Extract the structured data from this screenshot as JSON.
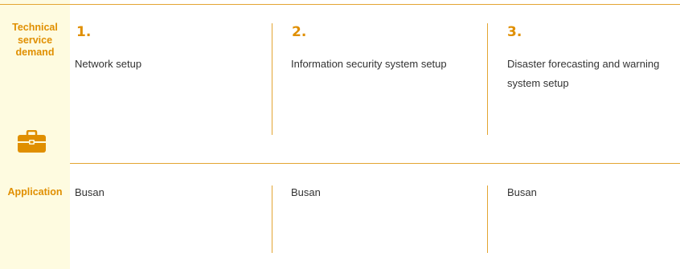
{
  "rows": {
    "technical_label": "Technical service demand",
    "application_label": "Application"
  },
  "items": [
    {
      "number": "1.",
      "description": "Network setup",
      "application": "Busan"
    },
    {
      "number": "2.",
      "description": "Information security system setup",
      "application": "Busan"
    },
    {
      "number": "3.",
      "description": "Disaster forecasting and warning system setup",
      "application": "Busan"
    }
  ],
  "icons": {
    "row_icon": "briefcase-icon"
  },
  "colors": {
    "accent": "#e08f00",
    "rule": "#e3a532",
    "side_bg": "#fefbe0",
    "text": "#333333"
  }
}
